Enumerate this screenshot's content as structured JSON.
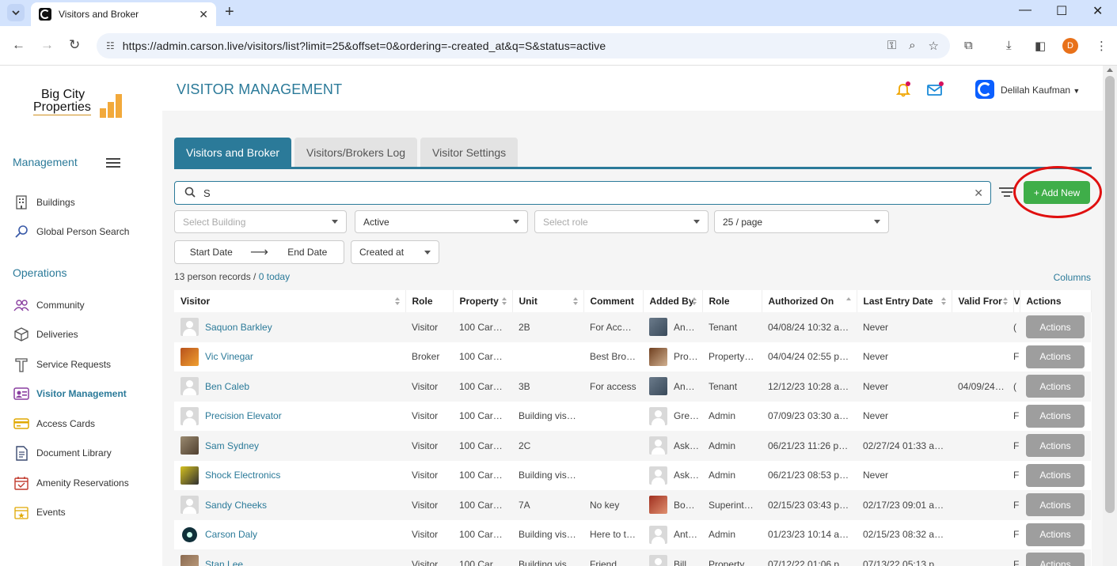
{
  "browser": {
    "tab_title": "Visitors and Broker",
    "url": "https://admin.carson.live/visitors/list?limit=25&offset=0&ordering=-created_at&q=S&status=active",
    "profile_initial": "D"
  },
  "sidebar": {
    "logo_line1": "Big City",
    "logo_line2": "Properties",
    "management_label": "Management",
    "operations_label": "Operations",
    "management_items": [
      {
        "label": "Buildings",
        "icon": "building-icon"
      },
      {
        "label": "Global Person Search",
        "icon": "search-icon"
      }
    ],
    "operations_items": [
      {
        "label": "Community",
        "icon": "people-icon"
      },
      {
        "label": "Deliveries",
        "icon": "box-icon"
      },
      {
        "label": "Service Requests",
        "icon": "wrench-icon"
      },
      {
        "label": "Visitor Management",
        "icon": "badge-icon"
      },
      {
        "label": "Access Cards",
        "icon": "card-icon"
      },
      {
        "label": "Document Library",
        "icon": "document-icon"
      },
      {
        "label": "Amenity Reservations",
        "icon": "calendar-icon"
      },
      {
        "label": "Events",
        "icon": "event-icon"
      }
    ]
  },
  "header": {
    "title": "VISITOR MANAGEMENT",
    "user_name": "Delilah Kaufman"
  },
  "tabs": [
    {
      "label": "Visitors and Broker",
      "active": true
    },
    {
      "label": "Visitors/Brokers Log",
      "active": false
    },
    {
      "label": "Visitor Settings",
      "active": false
    }
  ],
  "search": {
    "value": "S"
  },
  "add_new_label": "+ Add New",
  "filters": {
    "building_placeholder": "Select Building",
    "status_value": "Active",
    "role_placeholder": "Select role",
    "page_size": "25 / page",
    "start_date": "Start Date",
    "end_date": "End Date",
    "order_by": "Created at"
  },
  "summary": {
    "records": "13 person records / ",
    "today": "0 today"
  },
  "columns_label": "Columns",
  "table": {
    "headers": [
      "Visitor",
      "Role",
      "Property",
      "Unit",
      "Comment",
      "Added By",
      "Role",
      "Authorized On",
      "Last Entry Date",
      "Valid Fror",
      "V",
      "Actions"
    ],
    "action_label": "Actions",
    "rows": [
      {
        "visitor": "Saquon Barkley",
        "role": "Visitor",
        "property": "100 Cars…",
        "unit": "2B",
        "unit_link": true,
        "comment": "For Acce…",
        "added_by": "An…",
        "added_role": "Tenant",
        "authorized": "04/08/24 10:32 a…",
        "last_entry": "Never",
        "valid": "",
        "v": "(",
        "avatar": "generic",
        "added_avatar": "photo"
      },
      {
        "visitor": "Vic Vinegar",
        "role": "Broker",
        "property": "100 Cars…",
        "unit": "",
        "unit_link": false,
        "comment": "Best Bro…",
        "added_by": "Pro…",
        "added_role": "Property …",
        "authorized": "04/04/24 02:55 p…",
        "last_entry": "Never",
        "valid": "",
        "v": "F",
        "avatar": "vic",
        "added_avatar": "pro"
      },
      {
        "visitor": "Ben Caleb",
        "role": "Visitor",
        "property": "100 Cars…",
        "unit": "3B",
        "unit_link": true,
        "comment": "For access",
        "added_by": "An…",
        "added_role": "Tenant",
        "authorized": "12/12/23 10:28 a…",
        "last_entry": "Never",
        "valid": "04/09/24…",
        "v": "(",
        "avatar": "generic",
        "added_avatar": "photo"
      },
      {
        "visitor": "Precision Elevator",
        "role": "Visitor",
        "property": "100 Cars…",
        "unit": "Building visi…",
        "unit_link": false,
        "comment": "",
        "added_by": "Gre…",
        "added_role": "Admin",
        "authorized": "07/09/23 03:30 a…",
        "last_entry": "Never",
        "valid": "",
        "v": "F",
        "avatar": "generic",
        "added_avatar": "generic"
      },
      {
        "visitor": "Sam Sydney",
        "role": "Visitor",
        "property": "100 Cars…",
        "unit": "2C",
        "unit_link": true,
        "comment": "",
        "added_by": "Ask…",
        "added_role": "Admin",
        "authorized": "06/21/23 11:26 p…",
        "last_entry": "02/27/24 01:33 a…",
        "valid": "",
        "v": "F",
        "avatar": "sam",
        "added_avatar": "generic"
      },
      {
        "visitor": "Shock Electronics",
        "role": "Visitor",
        "property": "100 Cars…",
        "unit": "Building visi…",
        "unit_link": false,
        "comment": "",
        "added_by": "Ask…",
        "added_role": "Admin",
        "authorized": "06/21/23 08:53 p…",
        "last_entry": "Never",
        "valid": "",
        "v": "F",
        "avatar": "shock",
        "added_avatar": "generic"
      },
      {
        "visitor": "Sandy Cheeks",
        "role": "Visitor",
        "property": "100 Cars…",
        "unit": "7A",
        "unit_link": true,
        "comment": "No key",
        "added_by": "Bo…",
        "added_role": "Superinte…",
        "authorized": "02/15/23 03:43 p…",
        "last_entry": "02/17/23 09:01 a…",
        "valid": "",
        "v": "F",
        "avatar": "generic",
        "added_avatar": "bo"
      },
      {
        "visitor": "Carson Daly",
        "role": "Visitor",
        "property": "100 Cars…",
        "unit": "Building visi…",
        "unit_link": false,
        "comment": "Here to t…",
        "added_by": "Ant…",
        "added_role": "Admin",
        "authorized": "01/23/23 10:14 a…",
        "last_entry": "02/15/23 08:32 a…",
        "valid": "",
        "v": "F",
        "avatar": "carson",
        "added_avatar": "generic"
      },
      {
        "visitor": "Stan Lee",
        "role": "Visitor",
        "property": "100 Cars…",
        "unit": "Building visi…",
        "unit_link": false,
        "comment": "Friend",
        "added_by": "Bill…",
        "added_role": "Property…",
        "authorized": "07/12/22 01:06 p…",
        "last_entry": "07/13/22 05:13 p…",
        "valid": "",
        "v": "F",
        "avatar": "stan",
        "added_avatar": "generic"
      }
    ]
  },
  "colors": {
    "accent": "#2b7a99",
    "add_button": "#3fae49",
    "highlight_circle": "#e01010",
    "actions_button": "#9e9e9e"
  }
}
